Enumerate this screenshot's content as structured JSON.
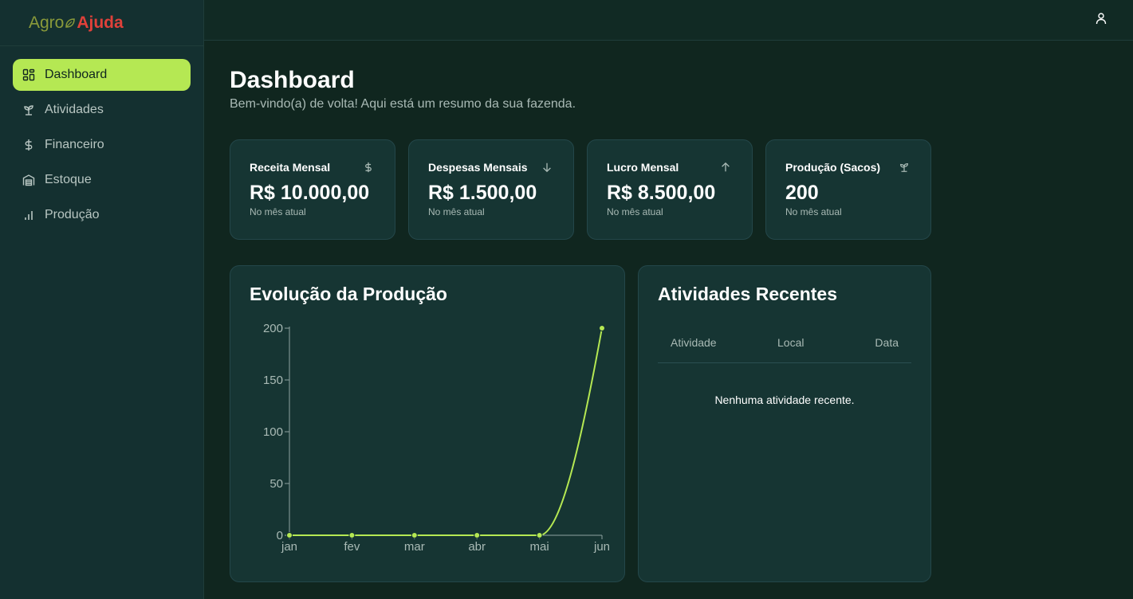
{
  "logo": {
    "part1": "Agro",
    "part2": "Ajuda"
  },
  "sidebar": {
    "items": [
      {
        "label": "Dashboard",
        "icon": "dashboard-icon",
        "active": true
      },
      {
        "label": "Atividades",
        "icon": "sprout-icon",
        "active": false
      },
      {
        "label": "Financeiro",
        "icon": "dollar-icon",
        "active": false
      },
      {
        "label": "Estoque",
        "icon": "warehouse-icon",
        "active": false
      },
      {
        "label": "Produção",
        "icon": "bar-chart-icon",
        "active": false
      }
    ]
  },
  "header": {
    "user_icon": "user-icon"
  },
  "page": {
    "title": "Dashboard",
    "subtitle": "Bem-vindo(a) de volta! Aqui está um resumo da sua fazenda."
  },
  "cards": [
    {
      "title": "Receita Mensal",
      "value": "R$ 10.000,00",
      "sub": "No mês atual",
      "icon": "dollar-icon"
    },
    {
      "title": "Despesas Mensais",
      "value": "R$ 1.500,00",
      "sub": "No mês atual",
      "icon": "arrow-down-icon"
    },
    {
      "title": "Lucro Mensal",
      "value": "R$ 8.500,00",
      "sub": "No mês atual",
      "icon": "arrow-up-icon"
    },
    {
      "title": "Produção (Sacos)",
      "value": "200",
      "sub": "No mês atual",
      "icon": "sprout-icon"
    }
  ],
  "production_panel": {
    "title": "Evolução da Produção"
  },
  "chart_data": {
    "type": "line",
    "title": "Evolução da Produção",
    "categories": [
      "jan",
      "fev",
      "mar",
      "abr",
      "mai",
      "jun"
    ],
    "values": [
      0,
      0,
      0,
      0,
      0,
      200
    ],
    "yticks": [
      0,
      50,
      100,
      150,
      200
    ],
    "ylim": [
      0,
      200
    ],
    "grid": false,
    "color": "#b5e853"
  },
  "activities_panel": {
    "title": "Atividades Recentes",
    "columns": [
      "Atividade",
      "Local",
      "Data"
    ],
    "empty_message": "Nenhuma atividade recente."
  },
  "colors": {
    "accent": "#b5e853",
    "background": "#10261f",
    "sidebar": "#143030",
    "card": "#163533",
    "logo_red": "#e0413a"
  }
}
